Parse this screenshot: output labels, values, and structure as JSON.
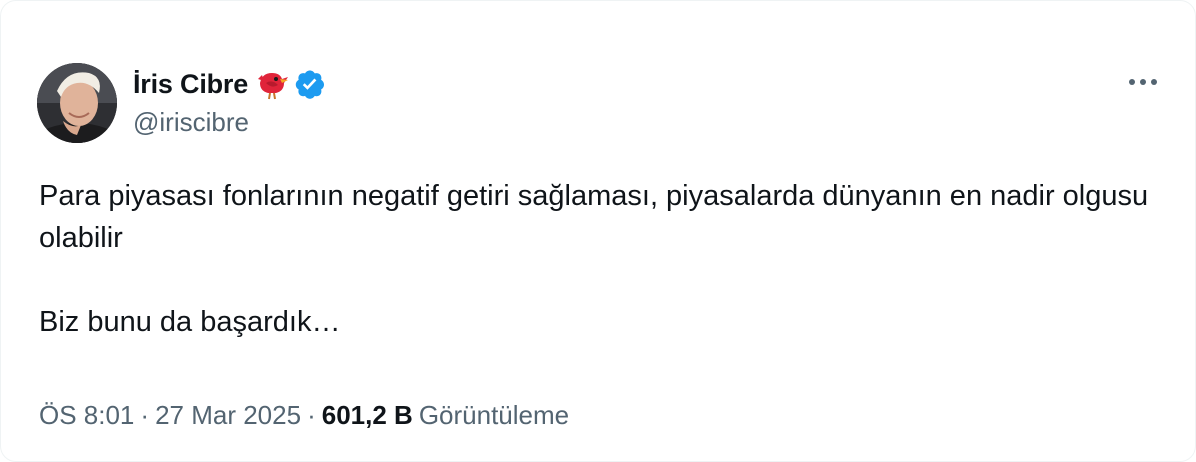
{
  "author": {
    "display_name": "İris Cibre",
    "handle": "@iriscibre",
    "badges": [
      "red-bird-emoji-icon",
      "verified-badge-icon"
    ],
    "verified_color": "#1d9bf0"
  },
  "menu": {
    "icon": "more-options-icon"
  },
  "tweet": {
    "text": "Para piyasası fonlarının negatif getiri sağlaması, piyasalarda dünyanın en nadir olgusu olabilir\n\nBiz bunu da başardık…"
  },
  "meta": {
    "time": "ÖS 8:01",
    "separator": "·",
    "date": "27 Mar 2025",
    "views_count": "601,2 B",
    "views_label": "Görüntüleme"
  },
  "colors": {
    "text_primary": "#0f1419",
    "text_secondary": "#536471",
    "accent": "#1d9bf0"
  }
}
